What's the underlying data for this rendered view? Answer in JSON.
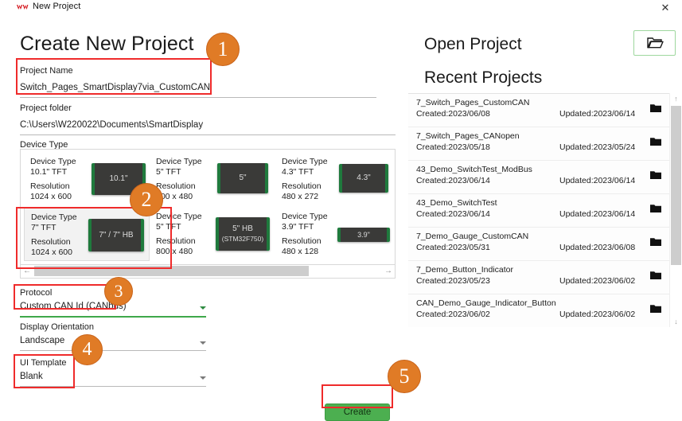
{
  "window": {
    "title": "New Project",
    "logo_icon": "wachendorff-logo-icon",
    "close_label": "✕"
  },
  "left": {
    "heading": "Create New Project",
    "project_name": {
      "label": "Project Name",
      "value": "Switch_Pages_SmartDisplay7via_CustomCAN"
    },
    "project_folder": {
      "label": "Project folder",
      "value": "C:\\Users\\W220022\\Documents\\SmartDisplay"
    },
    "device_type": {
      "label": "Device Type",
      "items": [
        {
          "type_label": "Device Type",
          "type_value": "10.1\" TFT",
          "res_label": "Resolution",
          "res_value": "1024 x 600",
          "thumb": "10.1\"",
          "thumb_sub": "",
          "selected": false
        },
        {
          "type_label": "Device Type",
          "type_value": "5\" TFT",
          "res_label": "Resolution",
          "res_value": "800 x 480",
          "thumb": "5\"",
          "thumb_sub": "",
          "selected": false
        },
        {
          "type_label": "Device Type",
          "type_value": "4.3\" TFT",
          "res_label": "Resolution",
          "res_value": "480 x 272",
          "thumb": "4.3\"",
          "thumb_sub": "",
          "selected": false
        },
        {
          "type_label": "Device Type",
          "type_value": "7\" TFT",
          "res_label": "Resolution",
          "res_value": "1024 x 600",
          "thumb": "7\" / 7\" HB",
          "thumb_sub": "",
          "selected": true
        },
        {
          "type_label": "Device Type",
          "type_value": "5\" TFT",
          "res_label": "Resolution",
          "res_value": "800 x 480",
          "thumb": "5\" HB",
          "thumb_sub": "(STM32F750)",
          "selected": false
        },
        {
          "type_label": "Device Type",
          "type_value": "3.9\" TFT",
          "res_label": "Resolution",
          "res_value": "480 x 128",
          "thumb": "3.9\"",
          "thumb_sub": "",
          "selected": false
        }
      ],
      "scroll_left_icon": "arrow-left-icon",
      "scroll_right_icon": "arrow-right-icon"
    },
    "protocol": {
      "label": "Protocol",
      "value": "Custom CAN Id (CANbus)"
    },
    "orientation": {
      "label": "Display Orientation",
      "value": "Landscape"
    },
    "ui_template": {
      "label": "UI Template",
      "value": "Blank"
    },
    "create_button": "Create"
  },
  "right": {
    "open_project_heading": "Open Project",
    "open_folder_icon": "folder-open-icon",
    "recent_heading": "Recent Projects",
    "recent_projects": [
      {
        "name": "7_Switch_Pages_CustomCAN",
        "created": "Created:2023/06/08",
        "updated": "Updated:2023/06/14"
      },
      {
        "name": "7_Switch_Pages_CANopen",
        "created": "Created:2023/05/18",
        "updated": "Updated:2023/05/24"
      },
      {
        "name": "43_Demo_SwitchTest_ModBus",
        "created": "Created:2023/06/14",
        "updated": "Updated:2023/06/14"
      },
      {
        "name": "43_Demo_SwitchTest",
        "created": "Created:2023/06/14",
        "updated": "Updated:2023/06/14"
      },
      {
        "name": "7_Demo_Gauge_CustomCAN",
        "created": "Created:2023/05/31",
        "updated": "Updated:2023/06/08"
      },
      {
        "name": "7_Demo_Button_Indicator",
        "created": "Created:2023/05/23",
        "updated": "Updated:2023/06/02"
      },
      {
        "name": "CAN_Demo_Gauge_Indicator_Button",
        "created": "Created:2023/06/02",
        "updated": "Updated:2023/06/02"
      }
    ],
    "scroll_up_icon": "arrow-up-icon",
    "scroll_down_icon": "arrow-down-icon"
  },
  "annotations": {
    "badges": [
      {
        "number": "1"
      },
      {
        "number": "2"
      },
      {
        "number": "3"
      },
      {
        "number": "4"
      },
      {
        "number": "5"
      }
    ],
    "badge_color": "#E07B26",
    "highlight_color": "#EF2B2B",
    "accent_green": "#3FA84A"
  }
}
